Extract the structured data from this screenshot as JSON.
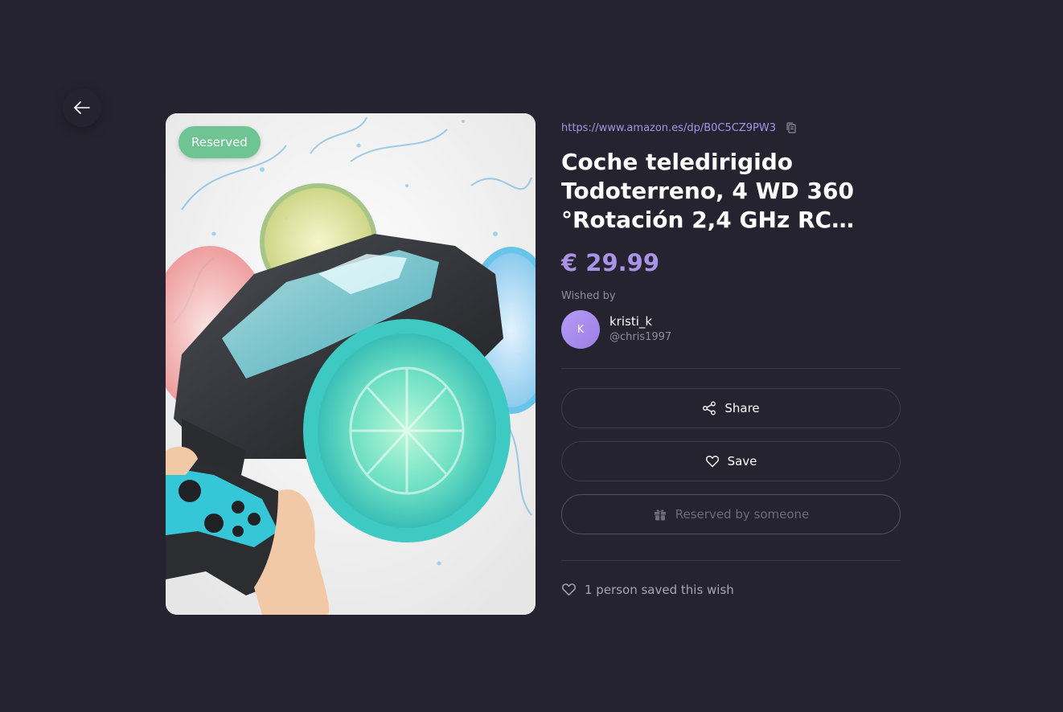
{
  "navigation": {
    "back_icon": "arrow-left-icon"
  },
  "product": {
    "url": "https://www.amazon.es/dp/B0C5CZ9PW3",
    "title": "Coche teledirigido Todoterreno, 4 WD 360 °Rotación 2,4 GHz RC Coche Anfibio Doble Cara Acrobacias con Luces",
    "price": "€ 29.99",
    "status_badge": "Reserved",
    "copy_icon": "copy-icon"
  },
  "wisher": {
    "label": "Wished by",
    "avatar_initial": "K",
    "name": "kristi_k",
    "handle": "@chris1997"
  },
  "actions": {
    "share_label": "Share",
    "save_label": "Save",
    "reserved_label": "Reserved by someone"
  },
  "stats": {
    "saved_text": "1 person saved this wish"
  },
  "colors": {
    "background": "#24232f",
    "accent": "#a993e6",
    "reserved_badge": "#6ec493",
    "muted_text": "#8f8d9c"
  }
}
